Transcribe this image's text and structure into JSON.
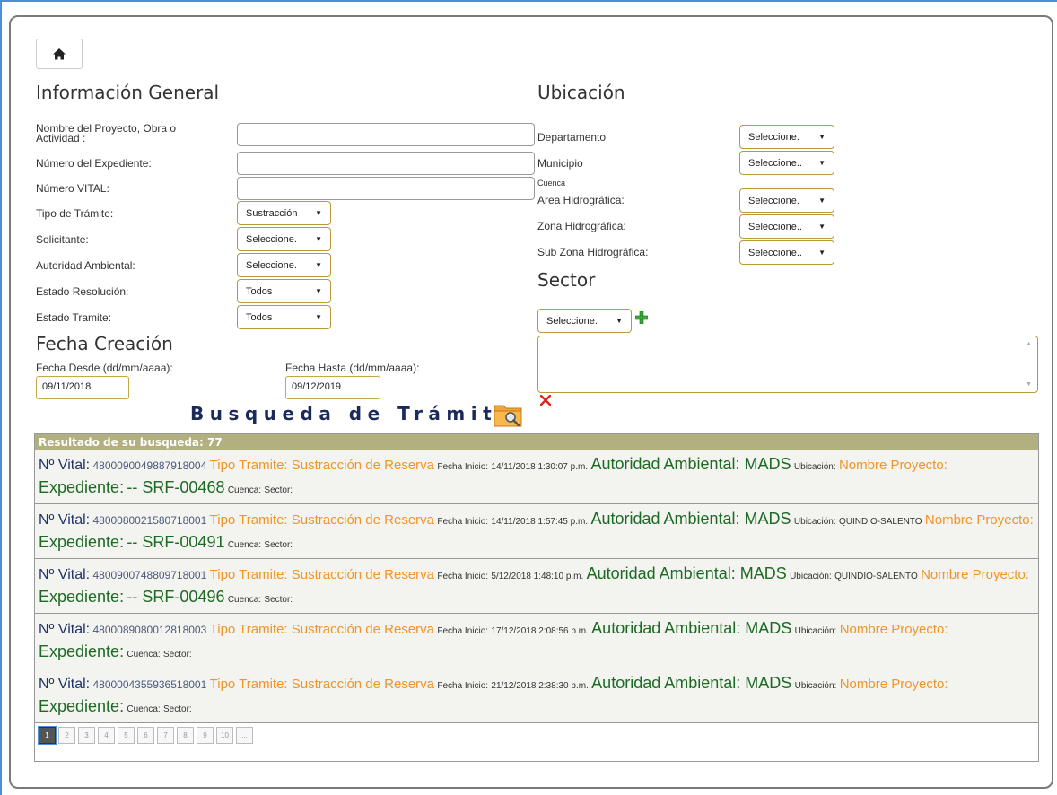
{
  "home": {
    "icon": "home-icon"
  },
  "info_general": {
    "title": "Información General",
    "fields": {
      "nombre_proyecto_label": "Nombre del Proyecto, Obra o Actividad :",
      "nombre_proyecto_value": "",
      "numero_expediente_label": "Número del Expediente:",
      "numero_expediente_value": "",
      "numero_vital_label": "Número VITAL:",
      "numero_vital_value": "",
      "tipo_tramite_label": "Tipo de Trámite:",
      "tipo_tramite_value": "Sustracción",
      "solicitante_label": "Solicitante:",
      "solicitante_value": "Seleccione.",
      "autoridad_label": "Autoridad Ambiental:",
      "autoridad_value": "Seleccione.",
      "estado_resolucion_label": "Estado Resolución:",
      "estado_resolucion_value": "Todos",
      "estado_tramite_label": "Estado Tramite:",
      "estado_tramite_value": "Todos"
    }
  },
  "fecha_creacion": {
    "title": "Fecha Creación",
    "desde_label": "Fecha Desde (dd/mm/aaaa):",
    "desde_value": "09/11/2018",
    "hasta_label": "Fecha Hasta (dd/mm/aaaa):",
    "hasta_value": "09/12/2019"
  },
  "ubicacion": {
    "title": "Ubicación",
    "departamento_label": "Departamento",
    "departamento_value": "Seleccione.",
    "municipio_label": "Municipio",
    "municipio_value": "Seleccione..",
    "cuenca_label": "Cuenca",
    "area_label": "Area Hidrográfica:",
    "area_value": "Seleccione.",
    "zona_label": "Zona Hidrográfica:",
    "zona_value": "Seleccione..",
    "subzona_label": "Sub Zona Hidrográfica:",
    "subzona_value": "Seleccione.."
  },
  "sector": {
    "title": "Sector",
    "select_value": "Seleccione.",
    "add_icon": "plus-icon",
    "remove_icon": "close-icon"
  },
  "search": {
    "title": "Busqueda de Trámite",
    "icon": "folder-search-icon"
  },
  "results": {
    "header": "Resultado de su busqueda: 77",
    "labels": {
      "vital": "Nº Vital:",
      "tipo": "Tipo Tramite: Sustracción de Reserva",
      "fecha": "Fecha Inicio:",
      "autoridad": "Autoridad Ambiental: MADS",
      "ubicacion": "Ubicación:",
      "nombre": "Nombre Proyecto:",
      "expediente": "Expediente:",
      "cuenca": "Cuenca:",
      "sector": "Sector:"
    },
    "rows": [
      {
        "vital": "4800090049887918004",
        "fecha": "14/11/2018 1:30:07 p.m.",
        "ubicacion": "",
        "expediente": "-- SRF-00468"
      },
      {
        "vital": "4800080021580718001",
        "fecha": "14/11/2018 1:57:45 p.m.",
        "ubicacion": "QUINDIO-SALENTO",
        "expediente": "-- SRF-00491"
      },
      {
        "vital": "4800900748809718001",
        "fecha": "5/12/2018 1:48:10 p.m.",
        "ubicacion": "QUINDIO-SALENTO",
        "expediente": "-- SRF-00496"
      },
      {
        "vital": "4800089080012818003",
        "fecha": "17/12/2018 2:08:56 p.m.",
        "ubicacion": "",
        "expediente": ""
      },
      {
        "vital": "4800004355936518001",
        "fecha": "21/12/2018 2:38:30 p.m.",
        "ubicacion": "",
        "expediente": ""
      }
    ],
    "pages": [
      "1",
      "2",
      "3",
      "4",
      "5",
      "6",
      "7",
      "8",
      "9",
      "10",
      "..."
    ]
  }
}
